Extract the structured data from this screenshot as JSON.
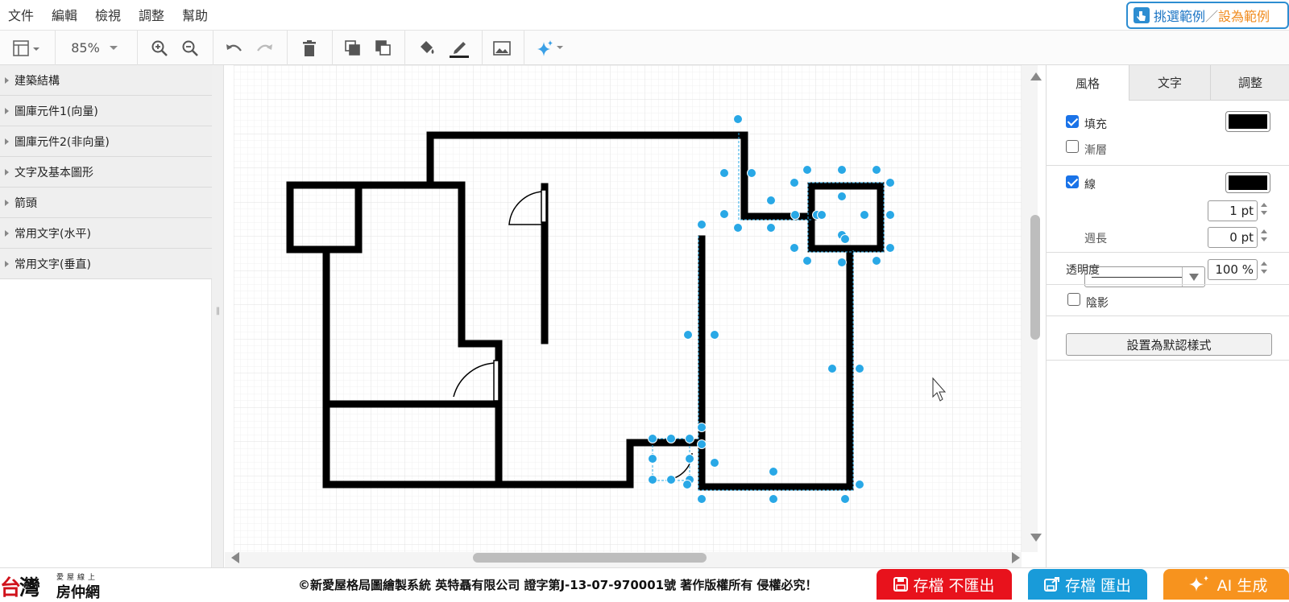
{
  "menu": {
    "items": [
      "文件",
      "編輯",
      "檢視",
      "調整",
      "幫助"
    ],
    "example_a": "挑選範例",
    "example_sep": "／",
    "example_b": "設為範例"
  },
  "toolbar": {
    "zoom": "85%"
  },
  "library": {
    "items": [
      "建築結構",
      "圖庫元件1(向量)",
      "圖庫元件2(非向量)",
      "文字及基本圖形",
      "箭頭",
      "常用文字(水平)",
      "常用文字(垂直)"
    ]
  },
  "panel": {
    "tabs": [
      "風格",
      "文字",
      "調整"
    ],
    "fill_label": "填充",
    "fill_checked": true,
    "fill_color": "#000000",
    "gradient_label": "漸層",
    "gradient_checked": false,
    "line_label": "線",
    "line_checked": true,
    "line_color": "#000000",
    "line_width": "1 pt",
    "perimeter_label": "週長",
    "perimeter_value": "0 pt",
    "opacity_label": "透明度",
    "opacity_value": "100 %",
    "shadow_label": "陰影",
    "shadow_checked": false,
    "default_style_button": "設置為默認樣式"
  },
  "footer": {
    "logo_main": "台灣",
    "logo_tiny": "愛屋線上",
    "logo_sub": "房仲網",
    "copyright": "©新愛屋格局圖繪製系統 英特聶有限公司 證字第J-13-07-970001號 著作版權所有 侵權必究！",
    "save_no_export": "存檔 不匯出",
    "save_export": "存檔 匯出",
    "ai_generate": "AI 生成"
  },
  "colors": {
    "accent": "#1a73e8",
    "selection": "#29a8e6",
    "save_no_export_bg": "#e8121c",
    "save_export_bg": "#199bd9",
    "ai_bg": "#f7931e"
  }
}
